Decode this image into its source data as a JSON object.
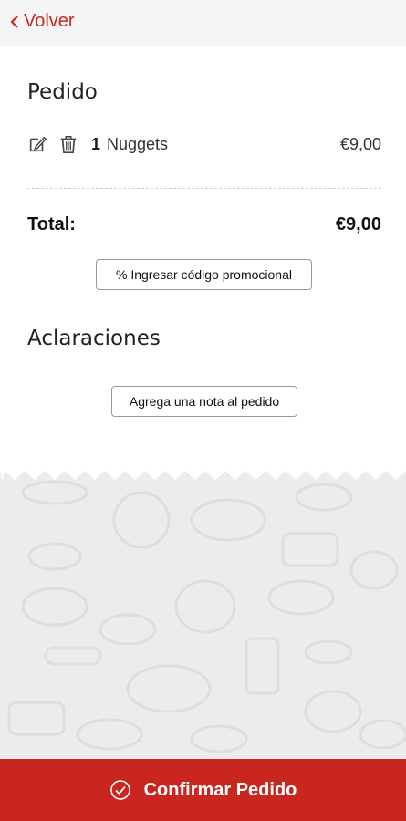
{
  "header": {
    "back_label": "Volver"
  },
  "order": {
    "title": "Pedido",
    "items": [
      {
        "qty": "1",
        "name": "Nuggets",
        "price": "€9,00"
      }
    ],
    "total_label": "Total:",
    "total_value": "€9,00",
    "promo_label": "% Ingresar código promocional"
  },
  "notes": {
    "title": "Aclaraciones",
    "add_note_label": "Agrega una nota al pedido"
  },
  "footer": {
    "confirm_label": "Confirmar Pedido"
  },
  "colors": {
    "accent": "#c8261f",
    "background": "#ececec",
    "card": "#ffffff"
  },
  "icons": [
    "chevron-left-icon",
    "edit-icon",
    "trash-icon",
    "check-circle-icon"
  ]
}
